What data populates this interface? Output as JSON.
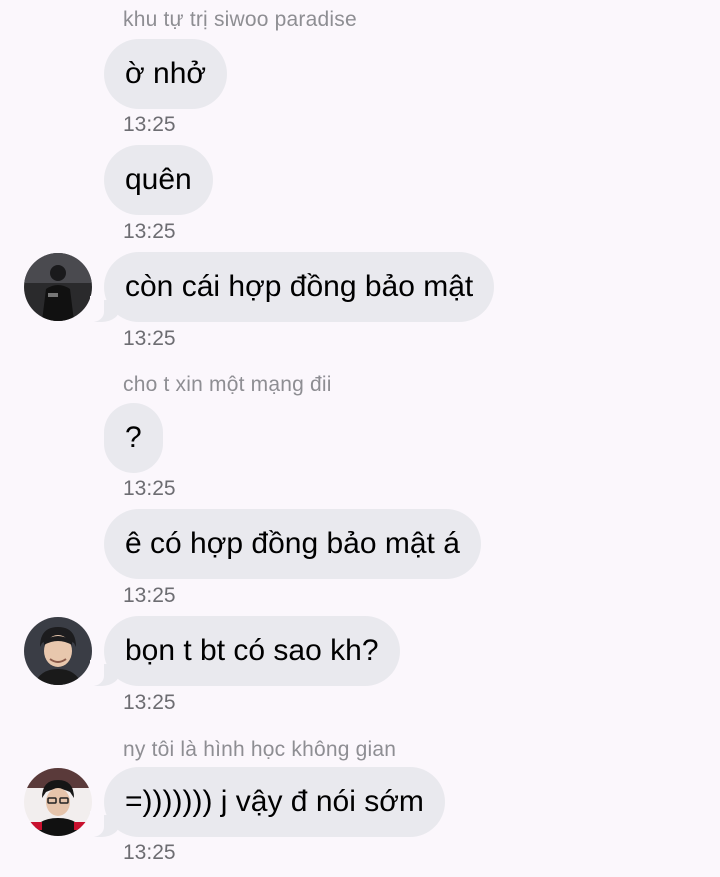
{
  "messages": [
    {
      "sender": "khu tự trị siwoo paradise",
      "text": "ờ nhở",
      "time": "13:25"
    },
    {
      "text": "quên",
      "time": "13:25"
    },
    {
      "text": "còn cái hợp đồng bảo mật",
      "time": "13:25"
    },
    {
      "sender": "cho t xin một mạng đii",
      "text": "?",
      "time": "13:25"
    },
    {
      "text": "ê có hợp đồng bảo mật á",
      "time": "13:25"
    },
    {
      "text": "bọn t bt có sao kh?",
      "time": "13:25"
    },
    {
      "sender": "ny tôi là hình học không gian",
      "text": "=))))))) j vậy đ nói sớm",
      "time": "13:25"
    }
  ],
  "colors": {
    "background": "#fbf7fc",
    "bubble": "#e9e9ee",
    "meta_text": "#8e8e93"
  }
}
